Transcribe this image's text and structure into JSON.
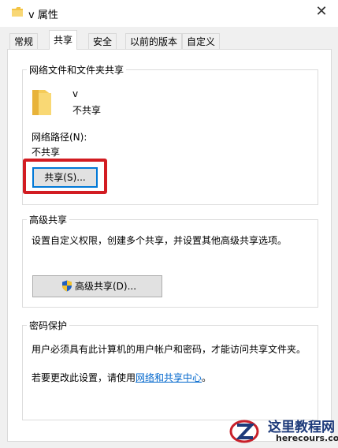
{
  "window": {
    "title": "v 属性"
  },
  "tabs": [
    "常规",
    "共享",
    "安全",
    "以前的版本",
    "自定义"
  ],
  "network_sharing": {
    "group_title": "网络文件和文件夹共享",
    "folder_name": "v",
    "folder_status": "不共享",
    "path_label": "网络路径(N):",
    "path_value": "不共享",
    "share_button": "共享(S)..."
  },
  "advanced_sharing": {
    "group_title": "高级共享",
    "description": "设置自定义权限，创建多个共享，并设置其他高级共享选项。",
    "button": "高级共享(D)..."
  },
  "password_protection": {
    "group_title": "密码保护",
    "description": "用户必须具有此计算机的用户帐户和密码，才能访问共享文件夹。",
    "change_prefix": "若要更改此设置，请使用",
    "link_text": "网络和共享中心",
    "change_suffix": "。"
  },
  "watermark": {
    "title": "这里教程网",
    "url": "herecours.com"
  }
}
